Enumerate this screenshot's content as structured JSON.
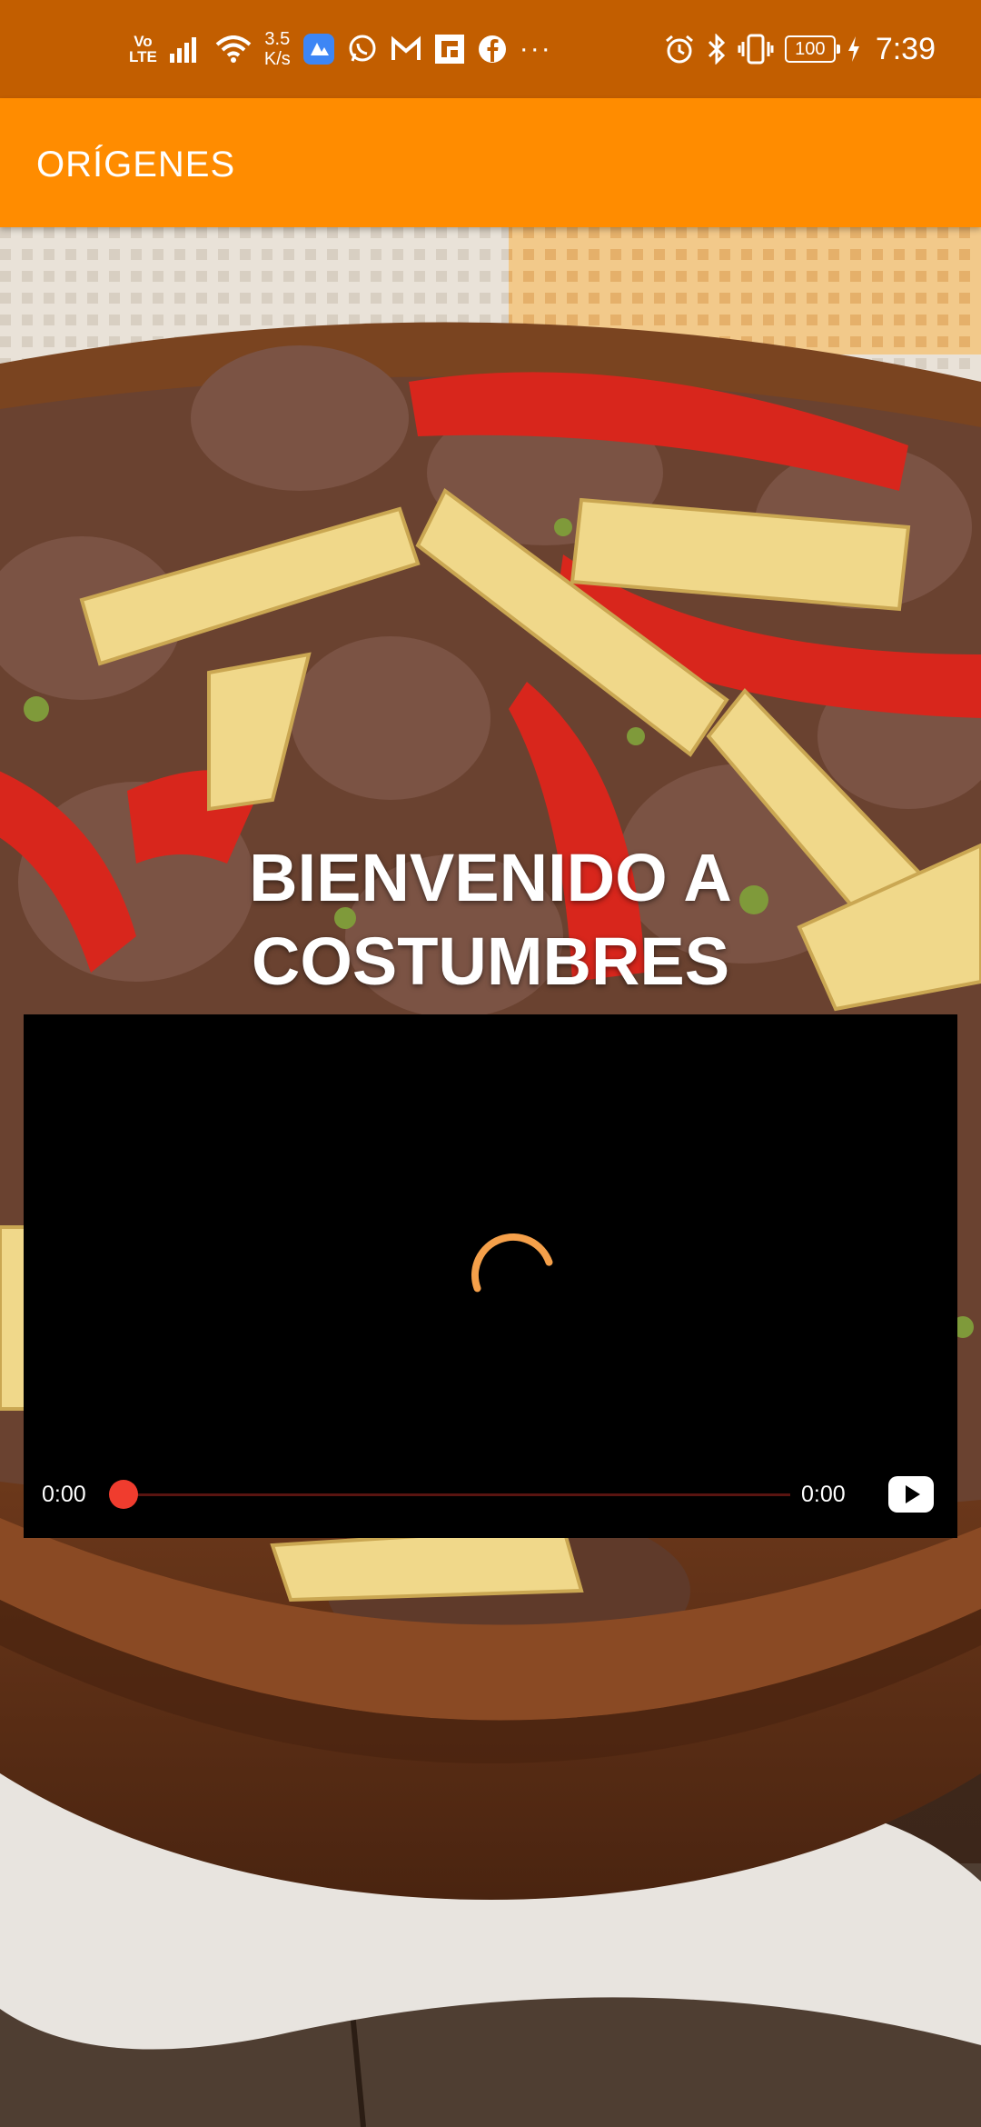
{
  "status_bar": {
    "volte": "Vo\nLTE",
    "net_speed_value": "3.5",
    "net_speed_unit": "K/s",
    "battery": "100",
    "time": "7:39",
    "more": "···",
    "icons": [
      "signal-icon",
      "wifi-icon",
      "app-badge-icon",
      "whatsapp-icon",
      "gmail-icon",
      "news-icon",
      "facebook-icon",
      "alarm-icon",
      "bluetooth-icon",
      "vibrate-icon",
      "battery-icon",
      "charging-icon"
    ]
  },
  "app_bar": {
    "title": "ORÍGENES",
    "background_color": "#ff8c00"
  },
  "welcome": {
    "line1": "BIENVENIDO A",
    "line2": "COSTUMBRES"
  },
  "video_player": {
    "current_time": "0:00",
    "total_time": "0:00",
    "progress": 0,
    "state": "loading",
    "spinner_color": "#f5a04a",
    "seek_color": "#f03c2e"
  }
}
